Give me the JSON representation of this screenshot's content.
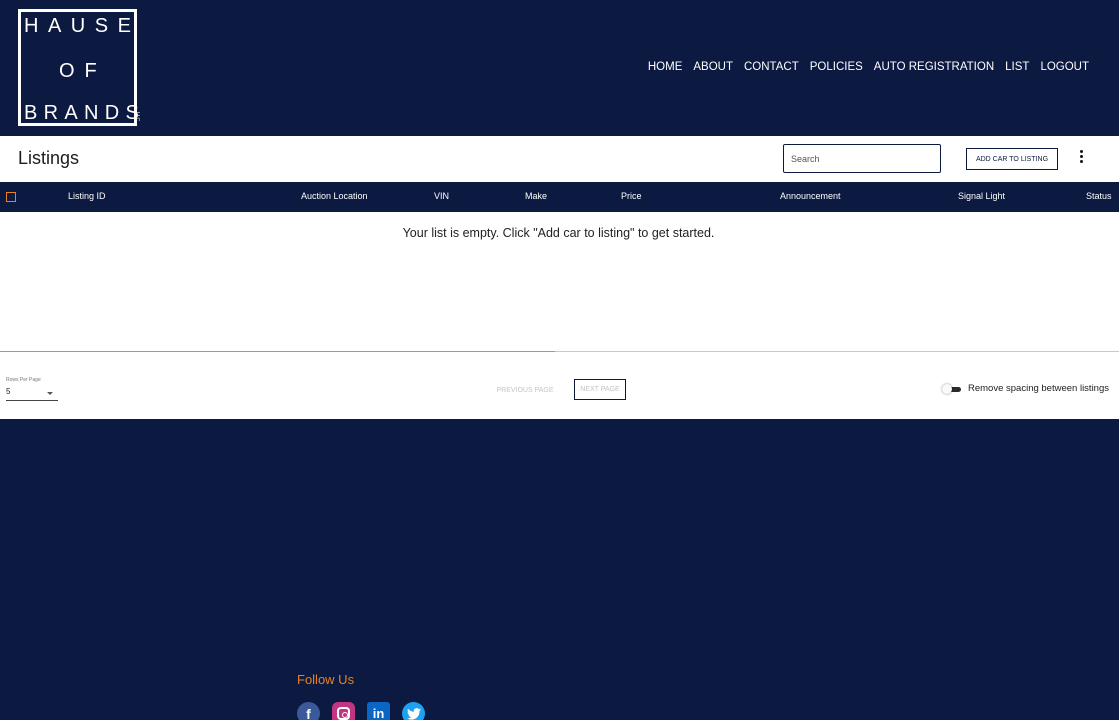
{
  "header": {
    "logo": {
      "line1": "HAUSE",
      "line2": "OF",
      "line3": "BRANDS",
      "suffix": "LLC"
    },
    "nav": [
      "HOME",
      "ABOUT",
      "CONTACT",
      "POLICIES",
      "AUTO REGISTRATION",
      "LIST",
      "LOGOUT"
    ]
  },
  "listings": {
    "title": "Listings",
    "search_placeholder": "Search",
    "add_button": "ADD CAR TO LISTING",
    "columns": [
      "Listing ID",
      "Auction Location",
      "VIN",
      "Make",
      "Price",
      "Announcement",
      "Signal Light",
      "Status"
    ],
    "empty_message": "Your list is empty. Click \"Add car to listing\" to get started.",
    "rows_per_page_label": "Rows Per Page",
    "rows_per_page_value": "5",
    "prev_label": "PREVIOUS PAGE",
    "next_label": "NEXT PAGE",
    "spacing_toggle_label": "Remove spacing between listings",
    "spacing_toggle_on": false
  },
  "footer": {
    "follow_label": "Follow Us",
    "social": [
      "facebook-icon",
      "instagram-icon",
      "linkedin-icon",
      "twitter-icon"
    ]
  },
  "colors": {
    "navy": "#0c1a42",
    "accent": "#e8821e",
    "white": "#ffffff"
  }
}
